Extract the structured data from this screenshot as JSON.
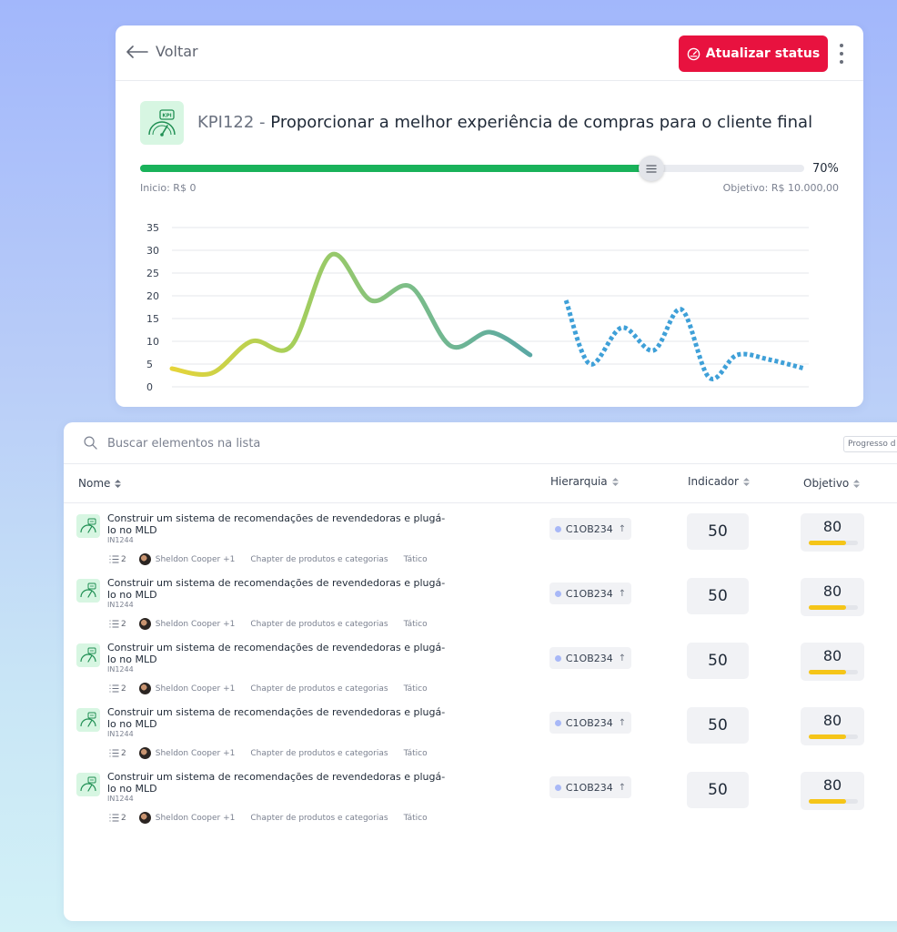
{
  "header": {
    "back_label": "Voltar",
    "update_button_label": "Atualizar status"
  },
  "kpi": {
    "code": "KPI122",
    "separator": " - ",
    "title": "Proporcionar a melhor experiência de compras para o cliente final",
    "icon_label": "KPI",
    "progress_percent": 70,
    "progress_label": "70%",
    "start_label": "Inicio: R$ 0",
    "goal_label": "Objetivo: R$ 10.000,00"
  },
  "chart_data": {
    "type": "line",
    "title": "",
    "xlabel": "",
    "ylabel": "",
    "ylim": [
      0,
      35
    ],
    "yticks": [
      0,
      5,
      10,
      15,
      20,
      25,
      30,
      35
    ],
    "grid": true,
    "legend": "none",
    "series": [
      {
        "style": "solid-gradient",
        "colors": [
          "#e6d43a",
          "#a6cf5a",
          "#7bbd89",
          "#5aa8a4"
        ],
        "x": [
          0,
          1,
          2,
          3,
          4,
          5,
          6,
          7,
          8,
          9
        ],
        "values": [
          4,
          3,
          10,
          9,
          29,
          19,
          22,
          9,
          12,
          7
        ]
      },
      {
        "style": "dotted",
        "colors": [
          "#3fa0d8"
        ],
        "x": [
          9.9,
          10.5,
          11.3,
          12.1,
          12.8,
          13.5,
          14.2,
          15.0,
          15.9
        ],
        "values": [
          19,
          5,
          13,
          8,
          17,
          2,
          7,
          6,
          4
        ]
      }
    ]
  },
  "list": {
    "search_placeholder": "Buscar elementos na lista",
    "progress_chip": "Progresso d",
    "columns": {
      "name": "Nome",
      "hierarchy": "Hierarquia",
      "indicator": "Indicador",
      "objective": "Objetivo"
    },
    "rows": [
      {
        "title": "Construir um sistema de recomendações de revendedoras e plugá-lo no MLD",
        "code": "IN1244",
        "count": "2",
        "owner": "Sheldon Cooper +1",
        "chapter": "Chapter de produtos e categorias",
        "level": "Tático",
        "hierarchy": "C1OB234",
        "indicator": "50",
        "objective": "80",
        "objective_progress": 0.75
      },
      {
        "title": "Construir um sistema de recomendações de revendedoras e plugá-lo no MLD",
        "code": "IN1244",
        "count": "2",
        "owner": "Sheldon Cooper +1",
        "chapter": "Chapter de produtos e categorias",
        "level": "Tático",
        "hierarchy": "C1OB234",
        "indicator": "50",
        "objective": "80",
        "objective_progress": 0.75
      },
      {
        "title": "Construir um sistema de recomendações de revendedoras e plugá-lo no MLD",
        "code": "IN1244",
        "count": "2",
        "owner": "Sheldon Cooper +1",
        "chapter": "Chapter de produtos e categorias",
        "level": "Tático",
        "hierarchy": "C1OB234",
        "indicator": "50",
        "objective": "80",
        "objective_progress": 0.75
      },
      {
        "title": "Construir um sistema de recomendações de revendedoras e plugá-lo no MLD",
        "code": "IN1244",
        "count": "2",
        "owner": "Sheldon Cooper +1",
        "chapter": "Chapter de produtos e categorias",
        "level": "Tático",
        "hierarchy": "C1OB234",
        "indicator": "50",
        "objective": "80",
        "objective_progress": 0.75
      },
      {
        "title": "Construir um sistema de recomendações de revendedoras e plugá-lo no MLD",
        "code": "IN1244",
        "count": "2",
        "owner": "Sheldon Cooper +1",
        "chapter": "Chapter de produtos e categorias",
        "level": "Tático",
        "hierarchy": "C1OB234",
        "indicator": "50",
        "objective": "80",
        "objective_progress": 0.75
      }
    ]
  },
  "colors": {
    "accent_red": "#e8123f",
    "progress_green": "#19b25a",
    "objective_yellow": "#f5c518",
    "icon_bg": "#d7f6e2"
  }
}
